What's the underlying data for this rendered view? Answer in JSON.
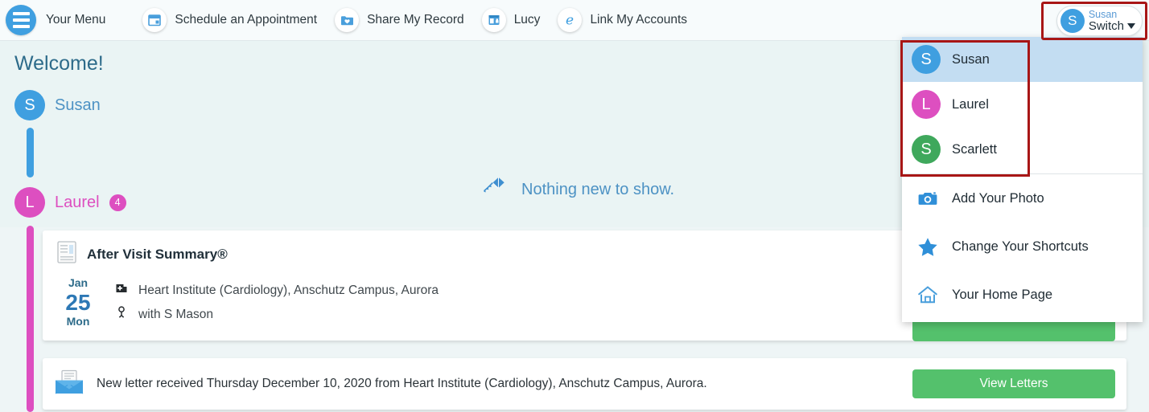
{
  "header": {
    "menu_label": "Your Menu",
    "items": [
      {
        "label": "Schedule an Appointment",
        "icon": "calendar-icon"
      },
      {
        "label": "Share My Record",
        "icon": "folder-share-icon"
      },
      {
        "label": "Lucy",
        "icon": "lucy-window-icon"
      },
      {
        "label": "Link My Accounts",
        "icon": "epic-e-icon"
      }
    ]
  },
  "switcher": {
    "name": "Susan",
    "action_label": "Switch",
    "avatar_initial": "S",
    "avatar_color": "#3f9fe0"
  },
  "dropdown": {
    "users": [
      {
        "name": "Susan",
        "initial": "S",
        "color": "#3f9fe0",
        "selected": true
      },
      {
        "name": "Laurel",
        "initial": "L",
        "color": "#dd4fc0",
        "selected": false
      },
      {
        "name": "Scarlett",
        "initial": "S",
        "color": "#3fa койка",
        "selected": false
      }
    ],
    "actions": [
      {
        "label": "Add Your Photo",
        "icon": "camera-icon"
      },
      {
        "label": "Change Your Shortcuts",
        "icon": "star-icon"
      },
      {
        "label": "Your Home Page",
        "icon": "home-icon"
      }
    ]
  },
  "welcome": {
    "title": "Welcome!",
    "people": [
      {
        "name": "Susan",
        "initial": "S",
        "color": "#3f9fe0",
        "badge": ""
      },
      {
        "name": "Laurel",
        "initial": "L",
        "color": "#dd4fc0",
        "badge": "4"
      }
    ],
    "empty_state": "Nothing new to show.",
    "empty_icon": "kite-icon"
  },
  "cards": {
    "avs": {
      "title": "After Visit Summary®",
      "icon": "document-icon",
      "date_month": "Jan",
      "date_day": "25",
      "date_dow": "Mon",
      "location": "Heart Institute (Cardiology), Anschutz Campus, Aurora",
      "location_icon": "hospital-icon",
      "provider": "with S Mason",
      "provider_icon": "person-icon"
    },
    "letter": {
      "icon": "envelope-icon",
      "text": "New letter received Thursday December 10, 2020 from Heart Institute (Cardiology), Anschutz Campus, Aurora.",
      "button_label": "View Letters"
    }
  },
  "colors": {
    "accent_blue": "#3f9fe0",
    "accent_pink": "#dd4fc0",
    "accent_green": "#3fa85c",
    "button_green": "#54c16c",
    "highlight_red": "#a81616",
    "selected_row": "#c3ddf2"
  }
}
